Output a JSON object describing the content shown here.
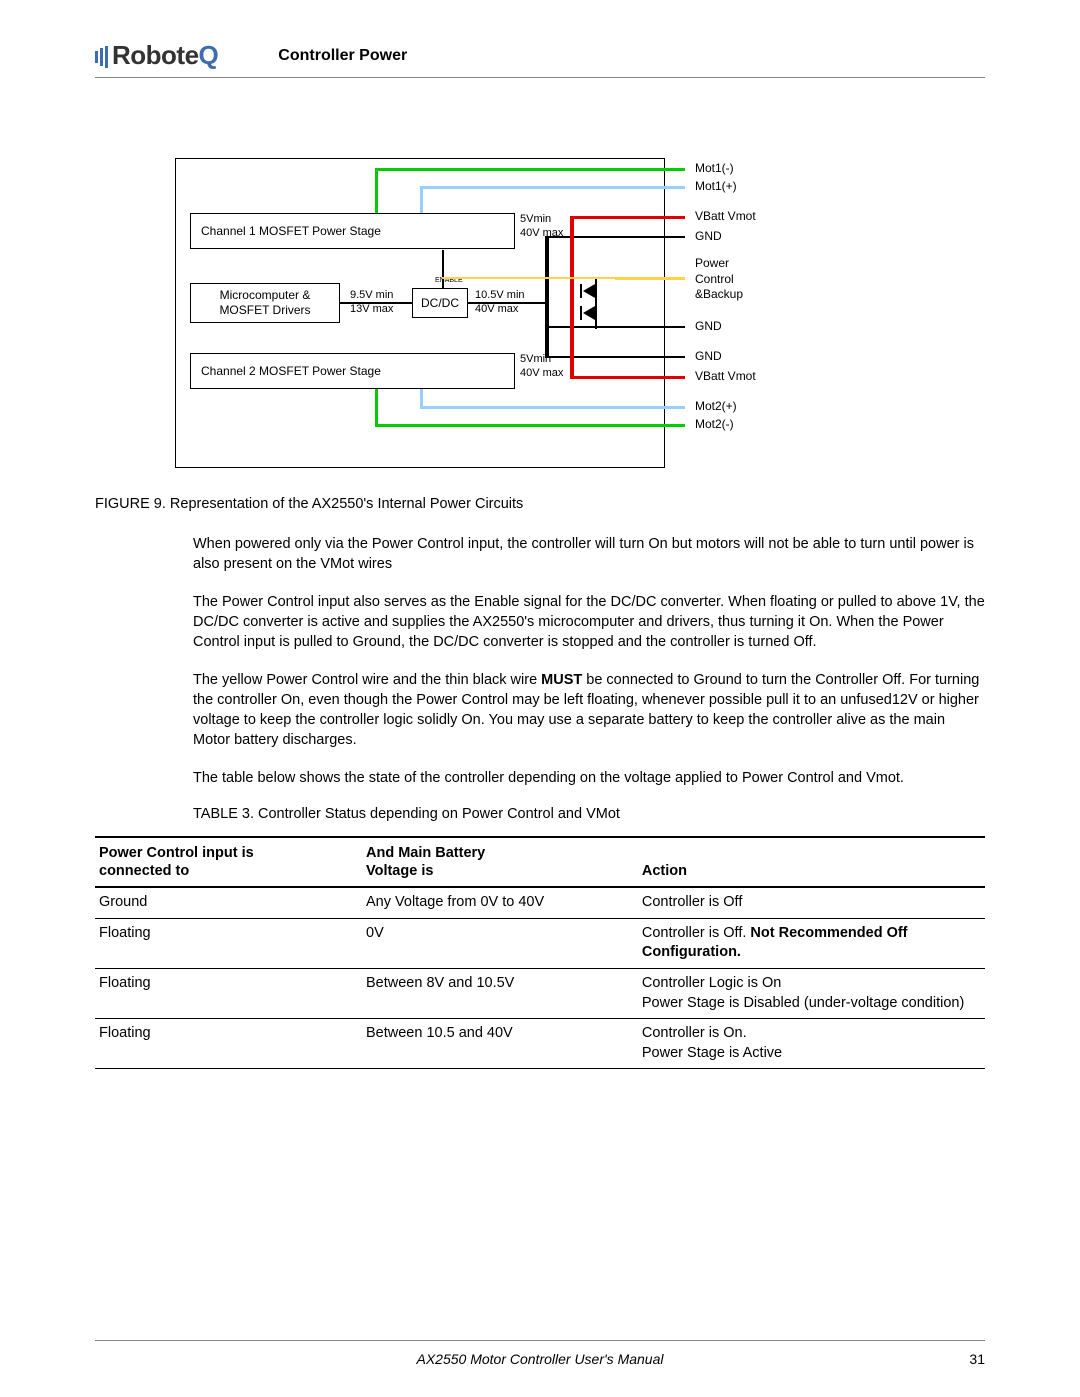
{
  "header": {
    "brand_prefix": "Robote",
    "brand_q": "Q",
    "section_title": "Controller Power"
  },
  "diagram": {
    "outer_box": "",
    "ch1_label": "Channel 1 MOSFET Power Stage",
    "ch1_volt": "5Vmin\n40V max",
    "micro_label": "Microcomputer &\nMOSFET Drivers",
    "micro_volt": "9.5V min\n13V max",
    "dcdc_label": "DC/DC",
    "dcdc_volt": "10.5V min\n40V max",
    "enable_label": "ENABLE",
    "ch2_label": "Channel 2 MOSFET Power Stage",
    "ch2_volt": "5Vmin\n40V max",
    "right_labels": {
      "mot1_neg": "Mot1(-)",
      "mot1_pos": "Mot1(+)",
      "vbatt1": "VBatt Vmot",
      "gnd1": "GND",
      "power_ctrl": "Power\nControl\n&Backup",
      "gnd2": "GND",
      "gnd3": "GND",
      "vbatt2": "VBatt Vmot",
      "mot2_pos": "Mot2(+)",
      "mot2_neg": "Mot2(-)"
    }
  },
  "figure_caption": "FIGURE 9.  Representation of the AX2550's Internal Power Circuits",
  "paragraphs": {
    "p1": "When powered only via the Power Control input, the controller will turn On but motors will not be able to turn until power is also present on the VMot wires",
    "p2": "The Power Control input also serves as the Enable signal for the DC/DC converter. When floating or pulled to above 1V, the DC/DC converter is active and supplies the AX2550's microcomputer and drivers, thus turning it On. When the Power Control input is pulled to Ground, the DC/DC converter is stopped and the controller is turned Off.",
    "p3_a": "The yellow Power Control wire and the thin black wire ",
    "p3_b": "MUST",
    "p3_c": " be connected to Ground to turn the Controller Off. For turning the controller On, even though the Power Control may be left floating, whenever possible pull it to an unfused12V or higher voltage to keep the controller logic solidly On. You may use a separate battery to keep the controller alive as the main Motor battery discharges.",
    "p4": "The table below shows the state of the controller depending on the voltage applied to Power Control and Vmot."
  },
  "table_caption": "TABLE 3. Controller Status depending on Power Control and VMot",
  "table": {
    "headers": {
      "col1": "Power Control input is\nconnected to",
      "col2": "And Main Battery\nVoltage is",
      "col3": "Action"
    },
    "rows": [
      {
        "c1": "Ground",
        "c2": "Any Voltage from 0V to 40V",
        "c3_a": "Controller is Off",
        "c3_b": ""
      },
      {
        "c1": "Floating",
        "c2": "0V",
        "c3_a": "Controller is Off. ",
        "c3_b": "Not Recommended Off Configuration."
      },
      {
        "c1": "Floating",
        "c2": "Between 8V and 10.5V",
        "c3_a": "Controller Logic is On\nPower Stage is Disabled (under-voltage condition)",
        "c3_b": ""
      },
      {
        "c1": "Floating",
        "c2": "Between 10.5 and 40V",
        "c3_a": "Controller is On.\nPower Stage is Active",
        "c3_b": ""
      }
    ]
  },
  "footer": {
    "title": "AX2550 Motor Controller User's Manual",
    "page": "31"
  }
}
